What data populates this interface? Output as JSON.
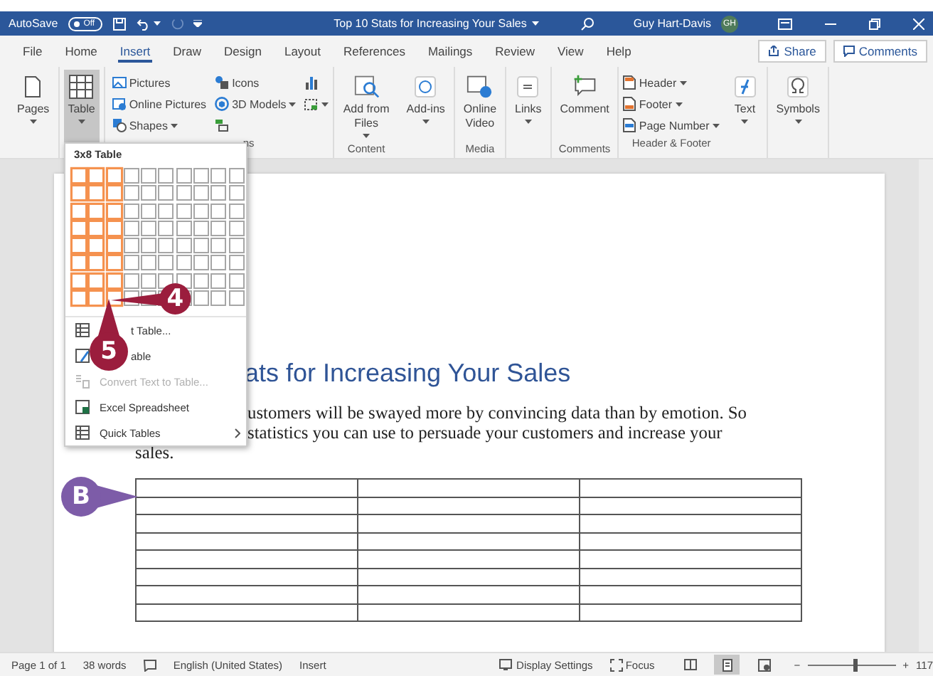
{
  "titlebar": {
    "autosave": {
      "label": "AutoSave",
      "toggle": "Off",
      "on": false
    },
    "title": "Top 10 Stats for Increasing Your Sales",
    "user": "Guy Hart-Davis",
    "avatar": "GH"
  },
  "tabs": [
    {
      "label": "File",
      "selected": false
    },
    {
      "label": "Home",
      "selected": false
    },
    {
      "label": "Insert",
      "selected": true
    },
    {
      "label": "Draw",
      "selected": false
    },
    {
      "label": "Design",
      "selected": false
    },
    {
      "label": "Layout",
      "selected": false
    },
    {
      "label": "References",
      "selected": false
    },
    {
      "label": "Mailings",
      "selected": false
    },
    {
      "label": "Review",
      "selected": false
    },
    {
      "label": "View",
      "selected": false
    },
    {
      "label": "Help",
      "selected": false
    }
  ],
  "share": "Share",
  "comments_button": "Comments",
  "ribbon": {
    "groups": [
      {
        "items": [
          {
            "kind": "large",
            "label": "Pages",
            "dropdown": true,
            "expanded": false
          }
        ]
      },
      {
        "items": [
          {
            "kind": "large",
            "label": "Table",
            "dropdown": true,
            "expanded": true
          }
        ]
      },
      {
        "label": "ns",
        "items": [
          {
            "kind": "small",
            "label": "Pictures",
            "dropdown": false
          },
          {
            "kind": "small",
            "label": "Online Pictures",
            "dropdown": false
          },
          {
            "kind": "small",
            "label": "Shapes",
            "dropdown": true
          },
          {
            "kind": "small",
            "label": "Icons",
            "dropdown": false
          },
          {
            "kind": "small",
            "label": "3D Models",
            "dropdown": true
          },
          {
            "kind": "small",
            "dropdown": false
          },
          {
            "kind": "small",
            "dropdown": false
          },
          {
            "kind": "small",
            "dropdown": true
          }
        ]
      },
      {
        "label": "Content",
        "items": [
          {
            "kind": "large",
            "label": "Add from Files",
            "dropdown": true,
            "expanded": false
          }
        ]
      },
      {
        "items": [
          {
            "kind": "large",
            "label": "Add-ins",
            "dropdown": true,
            "expanded": false
          }
        ]
      },
      {
        "label": "Media",
        "items": [
          {
            "kind": "large",
            "label": "Online Video",
            "dropdown": false,
            "expanded": false
          }
        ]
      },
      {
        "items": [
          {
            "kind": "large",
            "label": "Links",
            "dropdown": true,
            "expanded": false
          }
        ]
      },
      {
        "label": "Comments",
        "items": [
          {
            "kind": "large",
            "label": "Comment",
            "dropdown": false,
            "expanded": false
          }
        ]
      },
      {
        "label": "Header & Footer",
        "items": [
          {
            "kind": "small",
            "label": "Header",
            "dropdown": true
          },
          {
            "kind": "small",
            "label": "Footer",
            "dropdown": true
          },
          {
            "kind": "small",
            "label": "Page Number",
            "dropdown": true
          }
        ]
      },
      {
        "items": [
          {
            "kind": "large",
            "label": "Text",
            "dropdown": true,
            "expanded": false
          }
        ]
      },
      {
        "items": [
          {
            "kind": "large",
            "label": "Symbols",
            "dropdown": true,
            "expanded": false
          }
        ]
      }
    ]
  },
  "table_menu": {
    "title": "3x8 Table",
    "grid": [
      {
        "cells": [
          {
            "selected": true
          },
          {
            "selected": true
          },
          {
            "selected": true
          },
          {
            "selected": false
          },
          {
            "selected": false
          },
          {
            "selected": false
          },
          {
            "selected": false
          },
          {
            "selected": false
          },
          {
            "selected": false
          },
          {
            "selected": false
          }
        ]
      },
      {
        "cells": [
          {
            "selected": true
          },
          {
            "selected": true
          },
          {
            "selected": true
          },
          {
            "selected": false
          },
          {
            "selected": false
          },
          {
            "selected": false
          },
          {
            "selected": false
          },
          {
            "selected": false
          },
          {
            "selected": false
          },
          {
            "selected": false
          }
        ]
      },
      {
        "cells": [
          {
            "selected": true
          },
          {
            "selected": true
          },
          {
            "selected": true
          },
          {
            "selected": false
          },
          {
            "selected": false
          },
          {
            "selected": false
          },
          {
            "selected": false
          },
          {
            "selected": false
          },
          {
            "selected": false
          },
          {
            "selected": false
          }
        ]
      },
      {
        "cells": [
          {
            "selected": true
          },
          {
            "selected": true
          },
          {
            "selected": true
          },
          {
            "selected": false
          },
          {
            "selected": false
          },
          {
            "selected": false
          },
          {
            "selected": false
          },
          {
            "selected": false
          },
          {
            "selected": false
          },
          {
            "selected": false
          }
        ]
      },
      {
        "cells": [
          {
            "selected": true
          },
          {
            "selected": true
          },
          {
            "selected": true
          },
          {
            "selected": false
          },
          {
            "selected": false
          },
          {
            "selected": false
          },
          {
            "selected": false
          },
          {
            "selected": false
          },
          {
            "selected": false
          },
          {
            "selected": false
          }
        ]
      },
      {
        "cells": [
          {
            "selected": true
          },
          {
            "selected": true
          },
          {
            "selected": true
          },
          {
            "selected": false
          },
          {
            "selected": false
          },
          {
            "selected": false
          },
          {
            "selected": false
          },
          {
            "selected": false
          },
          {
            "selected": false
          },
          {
            "selected": false
          }
        ]
      },
      {
        "cells": [
          {
            "selected": true
          },
          {
            "selected": true
          },
          {
            "selected": true
          },
          {
            "selected": false
          },
          {
            "selected": false
          },
          {
            "selected": false
          },
          {
            "selected": false
          },
          {
            "selected": false
          },
          {
            "selected": false
          },
          {
            "selected": false
          }
        ]
      },
      {
        "cells": [
          {
            "selected": true
          },
          {
            "selected": true
          },
          {
            "selected": true
          },
          {
            "selected": false
          },
          {
            "selected": false
          },
          {
            "selected": false
          },
          {
            "selected": false
          },
          {
            "selected": false
          },
          {
            "selected": false
          },
          {
            "selected": false
          }
        ]
      }
    ],
    "items": [
      {
        "label": "t Table...",
        "disabled": false,
        "submenu": false
      },
      {
        "label": "able",
        "disabled": false,
        "submenu": false
      },
      {
        "label": "Convert Text to Table...",
        "disabled": true,
        "submenu": false
      },
      {
        "label": "Excel Spreadsheet",
        "disabled": false,
        "submenu": false
      },
      {
        "label": "Quick Tables",
        "disabled": false,
        "submenu": true
      }
    ]
  },
  "document": {
    "heading": "ats for Increasing Your Sales",
    "lines": [
      "ustomers will be swayed more by convincing data than by emotion. So",
      "statistics you can use to persuade your customers and increase your",
      "sales."
    ]
  },
  "callouts": [
    {
      "label": "4",
      "color": "#9b1d3d"
    },
    {
      "label": "5",
      "color": "#9b1d3d"
    },
    {
      "label": "B",
      "color": "#7d5ca8"
    }
  ],
  "status_bar": {
    "left": [
      "Page 1 of 1",
      "38 words",
      "English (United States)",
      "Insert"
    ],
    "display_settings": "Display Settings",
    "focus": "Focus",
    "views": [
      {
        "selected": false
      },
      {
        "selected": true
      },
      {
        "selected": false
      }
    ],
    "zoom": {
      "minus": "−",
      "plus": "+",
      "level": 0.55,
      "reading": "117"
    }
  }
}
